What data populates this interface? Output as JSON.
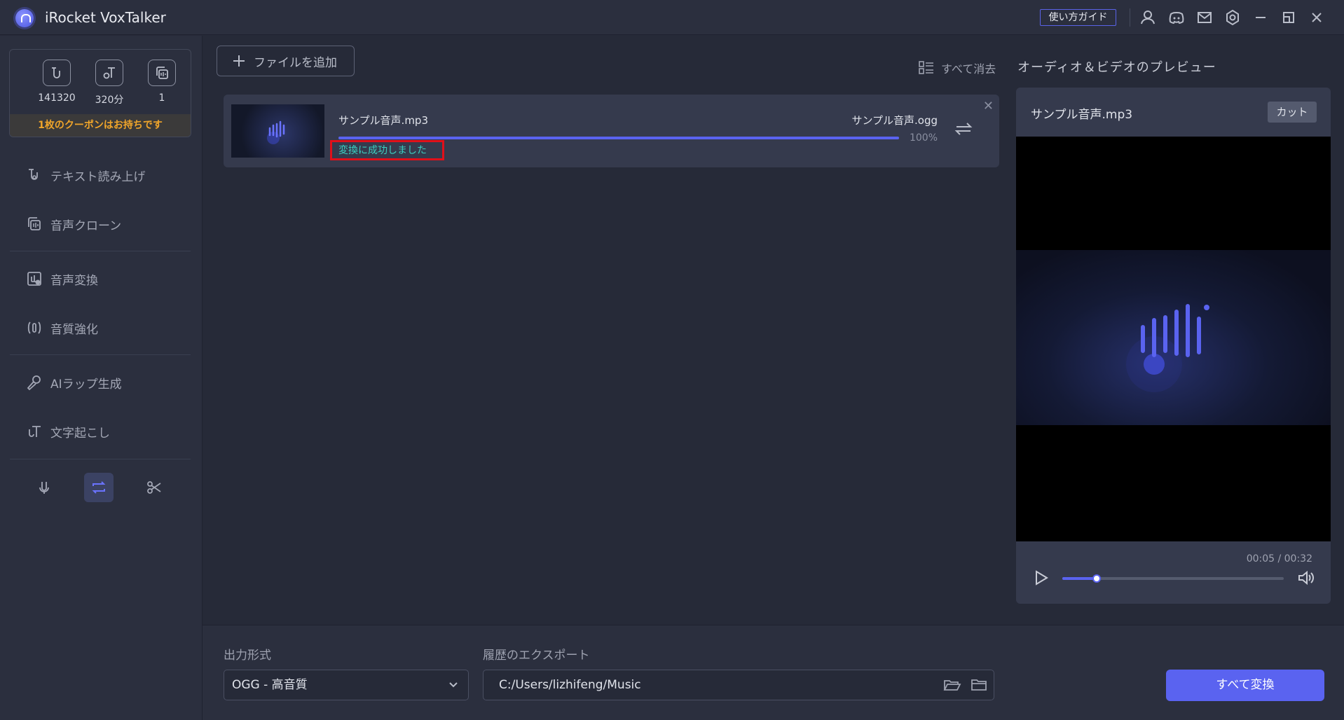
{
  "app": {
    "title": "iRocket VoxTalker",
    "guide_label": "使い方ガイド"
  },
  "titlebar_icons": [
    "user-icon",
    "discord-icon",
    "mail-icon",
    "settings-icon",
    "minimize-icon",
    "maximize-icon",
    "close-icon"
  ],
  "sidebar": {
    "stats": [
      {
        "icon": "tts-icon",
        "value": "141320"
      },
      {
        "icon": "minutes-icon",
        "value": "320分"
      },
      {
        "icon": "clone-count-icon",
        "value": "1"
      }
    ],
    "coupon": "1枚のクーポンはお持ちです",
    "nav": [
      {
        "label": "テキスト読み上げ",
        "icon": "text-to-speech-icon"
      },
      {
        "label": "音声クローン",
        "icon": "voice-clone-icon"
      },
      {
        "label": "音声変換",
        "icon": "voice-change-icon"
      },
      {
        "label": "音質強化",
        "icon": "audio-enhance-icon"
      },
      {
        "label": "AIラップ生成",
        "icon": "microphone-icon"
      },
      {
        "label": "文字起こし",
        "icon": "transcribe-icon"
      }
    ],
    "bottom_tools": [
      "mic-tool-icon",
      "convert-tool-icon",
      "cut-tool-icon"
    ]
  },
  "main": {
    "add_file": "ファイルを追加",
    "clear_all": "すべて消去",
    "file": {
      "input_name": "サンプル音声.mp3",
      "output_name": "サンプル音声.ogg",
      "progress": 100,
      "progress_label": "100%",
      "status": "変換に成功しました"
    }
  },
  "preview": {
    "title": "オーディオ＆ビデオのプレビュー",
    "file_name": "サンプル音声.mp3",
    "cut_label": "カット",
    "time": "00:05 / 00:32",
    "position_fraction": 0.156
  },
  "bottom": {
    "format_label": "出力形式",
    "format_value": "OGG - 高音質",
    "export_label": "履歴のエクスポート",
    "export_path": "C:/Users/lizhifeng/Music",
    "convert_all": "すべて変換"
  },
  "colors": {
    "accent": "#5a63f0",
    "success": "#3bcfc0",
    "coupon": "#f0a52a",
    "highlight": "#e0101a"
  }
}
